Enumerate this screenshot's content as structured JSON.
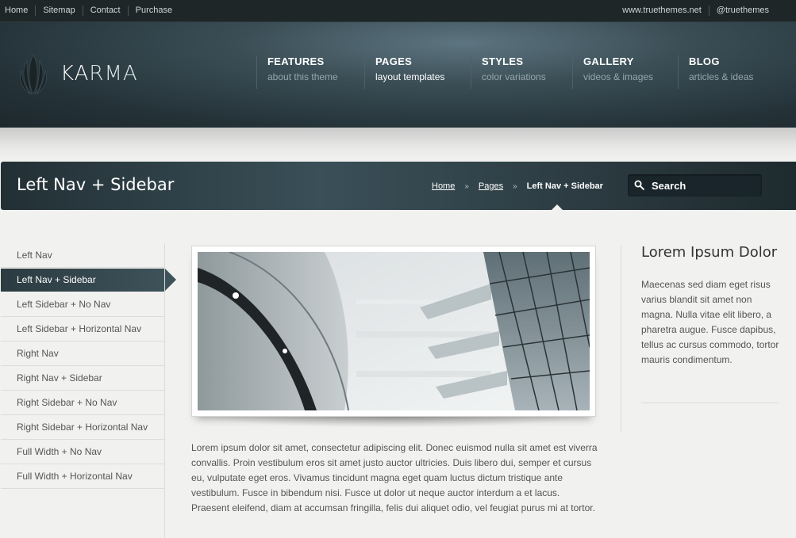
{
  "topbar": {
    "links": [
      "Home",
      "Sitemap",
      "Contact",
      "Purchase"
    ],
    "right": [
      "www.truethemes.net",
      "@truethemes"
    ]
  },
  "logo": {
    "bold": "KA",
    "light": "RMA"
  },
  "mainnav": [
    {
      "title": "FEATURES",
      "sub": "about this theme"
    },
    {
      "title": "PAGES",
      "sub": "layout templates"
    },
    {
      "title": "STYLES",
      "sub": "color variations"
    },
    {
      "title": "GALLERY",
      "sub": "videos & images"
    },
    {
      "title": "BLOG",
      "sub": "articles & ideas"
    }
  ],
  "page": {
    "title": "Left Nav + Sidebar",
    "breadcrumb": {
      "home": "Home",
      "sep": "»",
      "pages": "Pages",
      "current": "Left Nav + Sidebar"
    }
  },
  "search": {
    "placeholder": "Search"
  },
  "leftnav": [
    "Left Nav",
    "Left Nav + Sidebar",
    "Left Sidebar + No Nav",
    "Left Sidebar + Horizontal Nav",
    "Right Nav",
    "Right Nav + Sidebar",
    "Right Sidebar + No Nav",
    "Right Sidebar + Horizontal Nav",
    "Full Width + No Nav",
    "Full Width + Horizontal Nav"
  ],
  "content": {
    "paragraph": "Lorem ipsum dolor sit amet, consectetur adipiscing elit. Donec euismod nulla sit amet est viverra convallis. Proin vestibulum eros sit amet justo auctor ultricies. Duis libero dui, semper et cursus eu, vulputate eget eros. Vivamus tincidunt magna eget quam luctus dictum tristique ante vestibulum. Fusce in bibendum nisi. Fusce ut dolor ut neque auctor interdum a et lacus. Praesent eleifend, diam at accumsan fringilla, felis dui aliquet odio, vel feugiat purus mi at tortor."
  },
  "sidebar": {
    "title": "Lorem Ipsum Dolor",
    "text": "Maecenas sed diam eget risus varius blandit sit amet non magna. Nulla vitae elit libero, a pharetra augue. Fusce dapibus, tellus ac cursus commodo, tortor mauris condimentum."
  },
  "colors": {
    "header_dark": "#243238",
    "active_nav": "#3e525a",
    "background": "#f1f1ef"
  }
}
